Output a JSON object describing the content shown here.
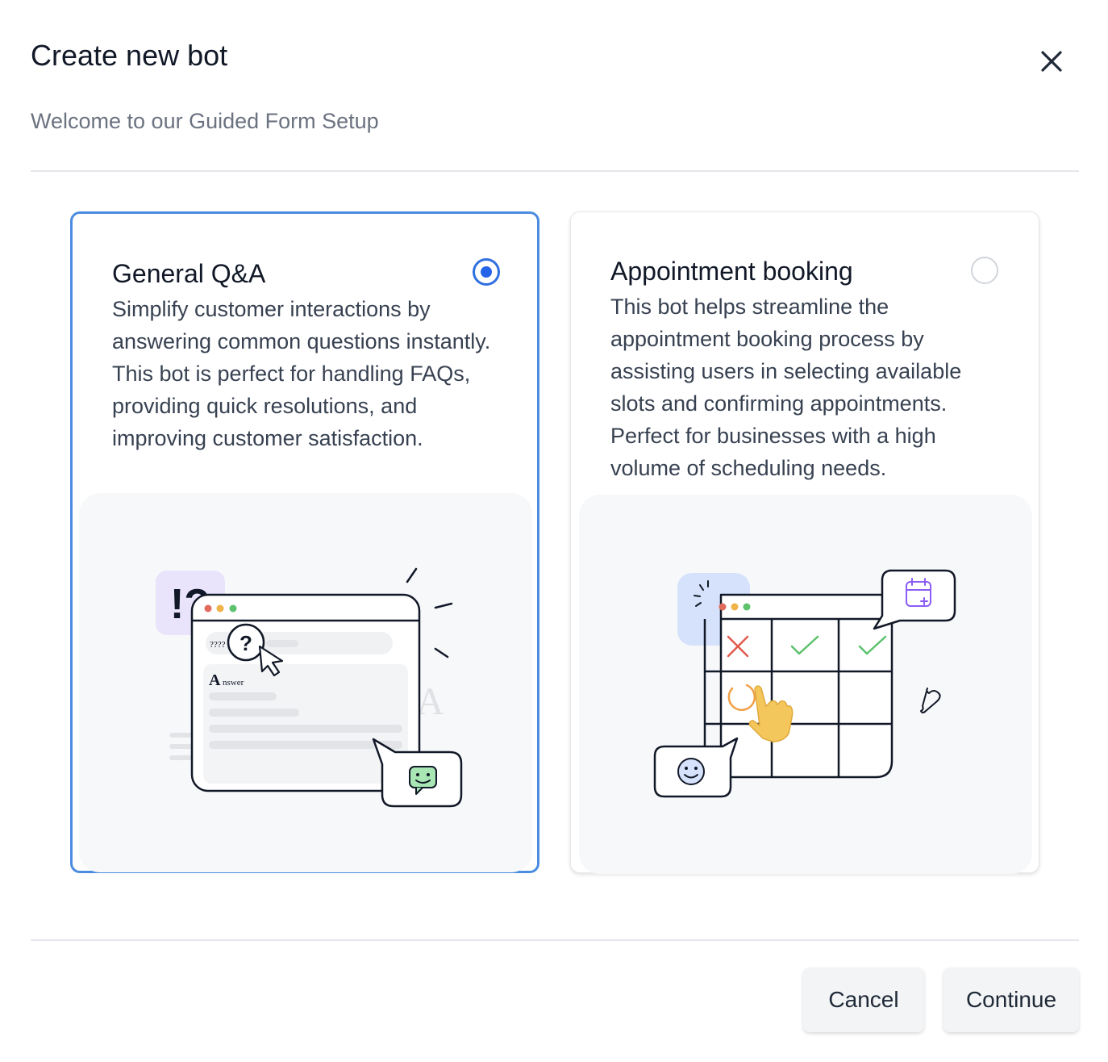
{
  "modal": {
    "title": "Create new bot",
    "subtitle": "Welcome to our Guided Form Setup",
    "close_icon": "close-icon"
  },
  "cards": [
    {
      "title": "General Q&A",
      "description": "Simplify customer interactions by answering common questions instantly. This bot is perfect for handling FAQs, providing quick resolutions, and improving customer satisfaction.",
      "selected": true,
      "illustration": {
        "badge_text": "!?",
        "question_text": "????",
        "question_mark": "?",
        "answer_initial": "A",
        "answer_text": "nswer",
        "watermark": "A"
      }
    },
    {
      "title": "Appointment booking",
      "description": "This bot helps streamline the appointment booking process by assisting users in selecting available slots and confirming appointments. Perfect for businesses with a high volume of scheduling needs.",
      "selected": false
    }
  ],
  "footer": {
    "cancel_label": "Cancel",
    "continue_label": "Continue"
  },
  "colors": {
    "selected_border": "#4a8ce0",
    "radio_fill": "#2563eb"
  }
}
